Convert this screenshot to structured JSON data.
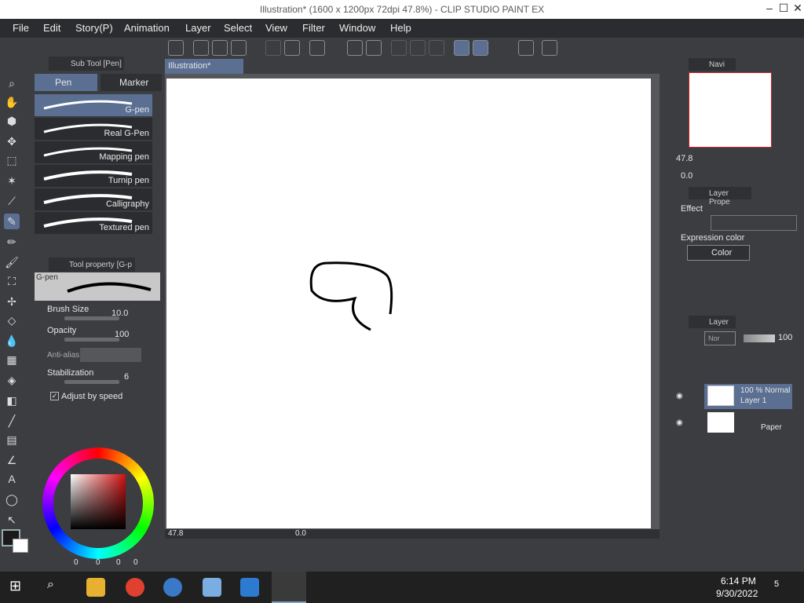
{
  "window": {
    "title": "Illustration* (1600 x 1200px 72dpi 47.8%) - CLIP STUDIO PAINT EX"
  },
  "menu": [
    "File",
    "Edit",
    "Story(P)",
    "Animation",
    "Layer",
    "Select",
    "View",
    "Filter",
    "Window",
    "Help"
  ],
  "subtool": {
    "header": "Sub Tool [Pen]",
    "tabs": [
      "Pen",
      "Marker"
    ],
    "brushes": [
      "G-pen",
      "Real G-Pen",
      "Mapping pen",
      "Turnip pen",
      "Calligraphy",
      "Textured pen"
    ],
    "selected_index": 0
  },
  "tool_property": {
    "header": "Tool property [G-p",
    "preview_label": "G-pen",
    "brush_size_label": "Brush Size",
    "brush_size_value": "10.0",
    "opacity_label": "Opacity",
    "opacity_value": "100",
    "antialias_label": "Anti-alias",
    "stabilization_label": "Stabilization",
    "stabilization_value": "6",
    "adjust_label": "Adjust by speed"
  },
  "color": {
    "fg": "#1a1a1a",
    "bg": "#ffffff",
    "values": [
      "0",
      "0",
      "0"
    ],
    "extra": "0"
  },
  "canvas": {
    "tab": "Illustration*",
    "zoom": "47.8",
    "angle": "0.0"
  },
  "navigator": {
    "tab": "Navi",
    "zoom": "47.8",
    "angle": "0.0"
  },
  "layer_property": {
    "tab": "Layer Prope",
    "effect_label": "Effect",
    "expression_label": "Expression color",
    "expression_value": "Color"
  },
  "layers": {
    "tab": "Layer",
    "blend_mode": "Nor",
    "opacity": "100",
    "items": [
      {
        "line1": "100 % Normal",
        "line2": "Layer 1",
        "selected": true
      },
      {
        "line1": "",
        "line2": "Paper",
        "selected": false
      }
    ]
  },
  "taskbar": {
    "time": "6:14 PM",
    "date": "9/30/2022",
    "notifications": "5"
  }
}
